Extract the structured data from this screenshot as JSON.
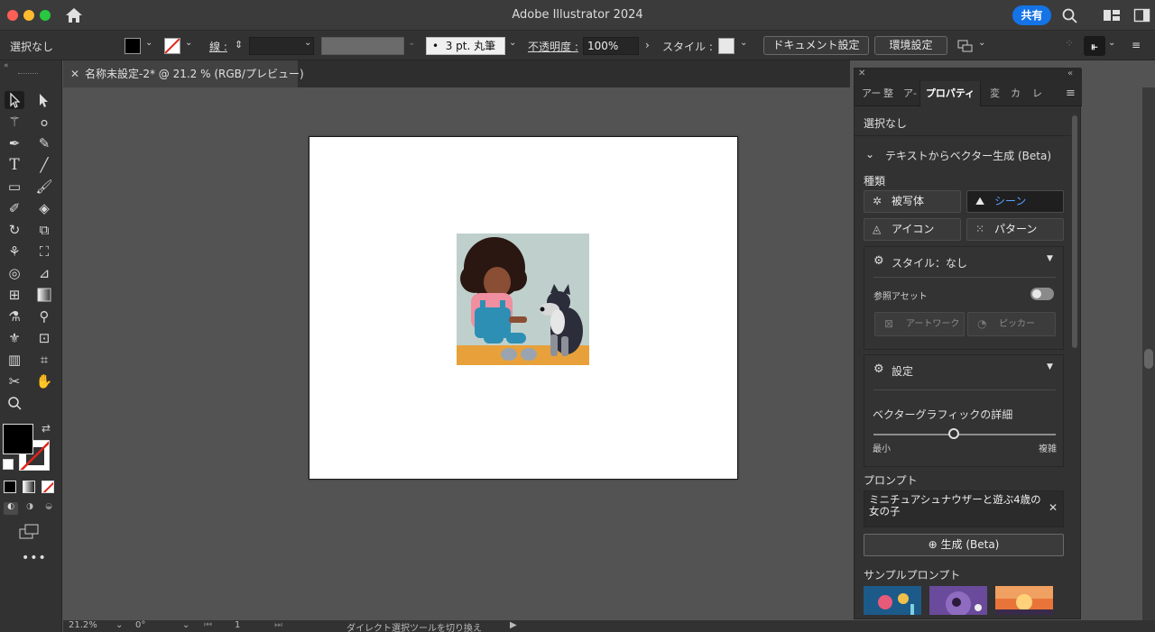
{
  "titlebar": {
    "title": "Adobe Illustrator 2024",
    "share_label": "共有"
  },
  "control": {
    "selection": "選択なし",
    "stroke_label": "線 :",
    "brush_value": "3 pt. 丸筆",
    "opacity_label": "不透明度 :",
    "opacity_value": "100%",
    "style_label": "スタイル :",
    "doc_settings": "ドキュメント設定",
    "env_settings": "環境設定"
  },
  "document": {
    "tab_title": "名称未設定-2* @ 21.2 % (RGB/プレビュー)"
  },
  "panel": {
    "tabs": [
      "アー",
      "整",
      "ア-",
      "プロパティ",
      "変",
      "カ",
      "レ"
    ],
    "active_tab": "プロパティ",
    "selection": "選択なし",
    "section_title": "テキストからベクター生成 (Beta)",
    "type_label": "種類",
    "types": {
      "subject": "被写体",
      "scene": "シーン",
      "icon": "アイコン",
      "pattern": "パターン"
    },
    "style_header": "スタイル：なし",
    "ref_asset_label": "参照アセット",
    "ref_asset_enabled": false,
    "artwork_btn": "アートワーク",
    "picker_btn": "ピッカー",
    "settings_header": "設定",
    "detail_label": "ベクターグラフィックの詳細",
    "detail_min": "最小",
    "detail_max": "複雑",
    "detail_level": 0.44,
    "prompt_label": "プロンプト",
    "prompt_text": "ミニチュアシュナウザーと遊ぶ4歳の女の子",
    "generate_label": "生成 (Beta)",
    "sample_prompts_label": "サンプルプロンプト"
  },
  "status": {
    "zoom": "21.2%",
    "rotation": "0°",
    "page": "1",
    "hint": "ダイレクト選択ツールを切り換え"
  },
  "colors": {
    "accent": "#1473e6",
    "panel_bg": "#323232",
    "canvas_bg": "#535353",
    "active_type": "#5aa0ff"
  }
}
